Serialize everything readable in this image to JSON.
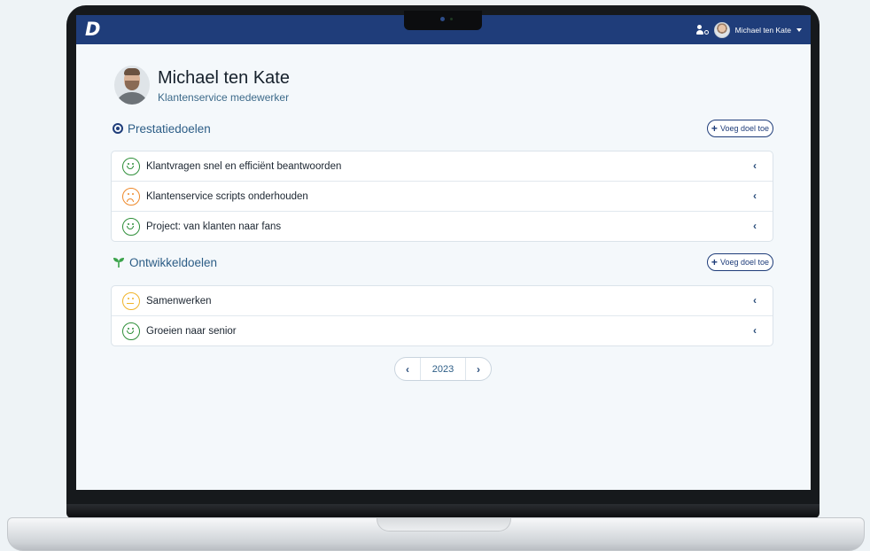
{
  "app": {
    "logo": "D"
  },
  "topbar": {
    "user_name": "Michael ten Kate",
    "icons": [
      "user-switch-icon",
      "avatar",
      "caret-down-icon"
    ]
  },
  "profile": {
    "name": "Michael ten Kate",
    "role": "Klantenservice medewerker"
  },
  "performance_goals": {
    "title": "Prestatiedoelen",
    "icon": "target-icon",
    "add_label": "Voeg doel toe",
    "items": [
      {
        "label": "Klantvragen snel en efficiënt beantwoorden",
        "mood": "happy"
      },
      {
        "label": "Klantenservice scripts onderhouden",
        "mood": "sad"
      },
      {
        "label": "Project: van klanten naar fans",
        "mood": "happy"
      }
    ]
  },
  "development_goals": {
    "title": "Ontwikkeldoelen",
    "icon": "sprout-icon",
    "add_label": "Voeg doel toe",
    "items": [
      {
        "label": "Samenwerken",
        "mood": "neutral"
      },
      {
        "label": "Groeien naar senior",
        "mood": "happy"
      }
    ]
  },
  "pager": {
    "prev": "‹",
    "year": "2023",
    "next": "›"
  },
  "colors": {
    "topbar": "#1f3d7a",
    "happy": "#2f8f3a",
    "sad": "#ee8a2c",
    "neutral": "#f0b429",
    "accent_text": "#2c5d86"
  }
}
